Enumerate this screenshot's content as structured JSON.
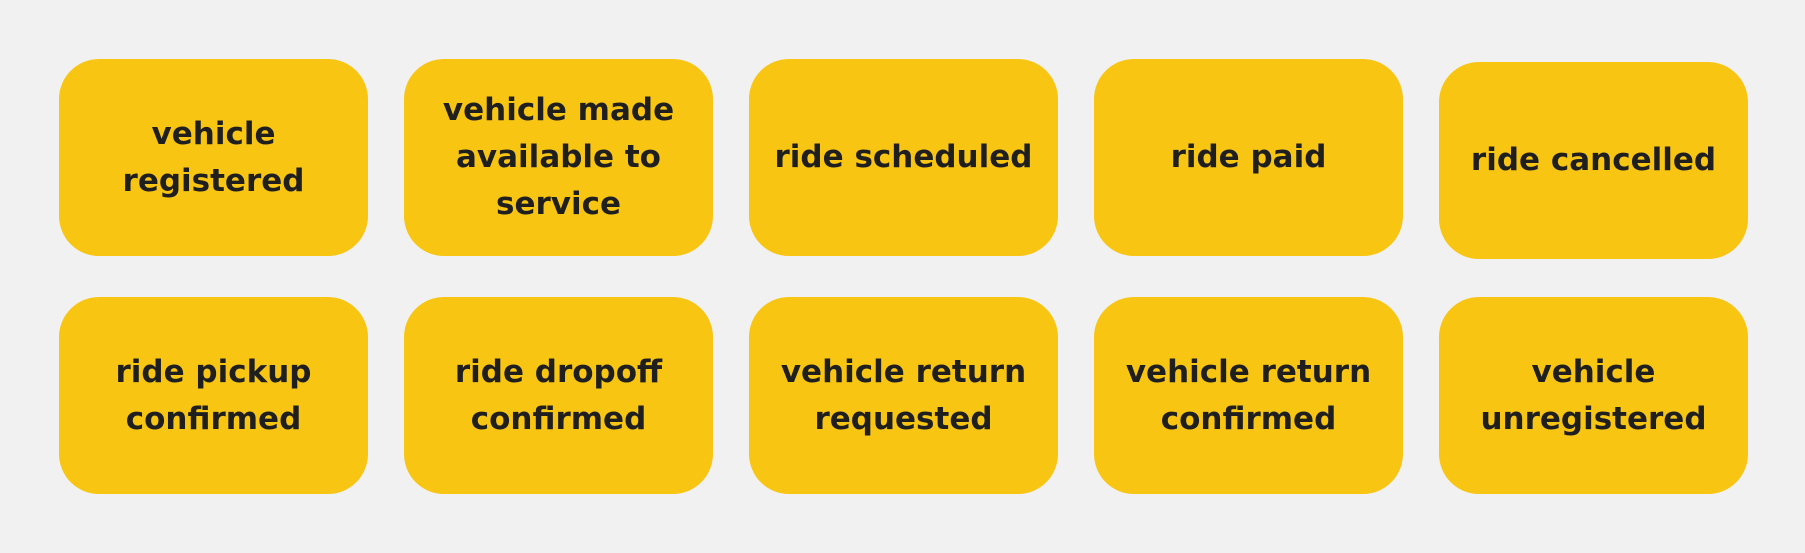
{
  "colors": {
    "background": "#f1f1f1",
    "card": "#f8c513",
    "text": "#1f1f1f"
  },
  "events": [
    {
      "label": "vehicle\nregistered"
    },
    {
      "label": "vehicle made\navailable to\nservice"
    },
    {
      "label": "ride scheduled"
    },
    {
      "label": "ride paid"
    },
    {
      "label": "ride cancelled"
    },
    {
      "label": "ride pickup\nconfirmed"
    },
    {
      "label": "ride dropoff\nconfirmed"
    },
    {
      "label": "vehicle return\nrequested"
    },
    {
      "label": "vehicle return\nconfirmed"
    },
    {
      "label": "vehicle\nunregistered"
    }
  ]
}
